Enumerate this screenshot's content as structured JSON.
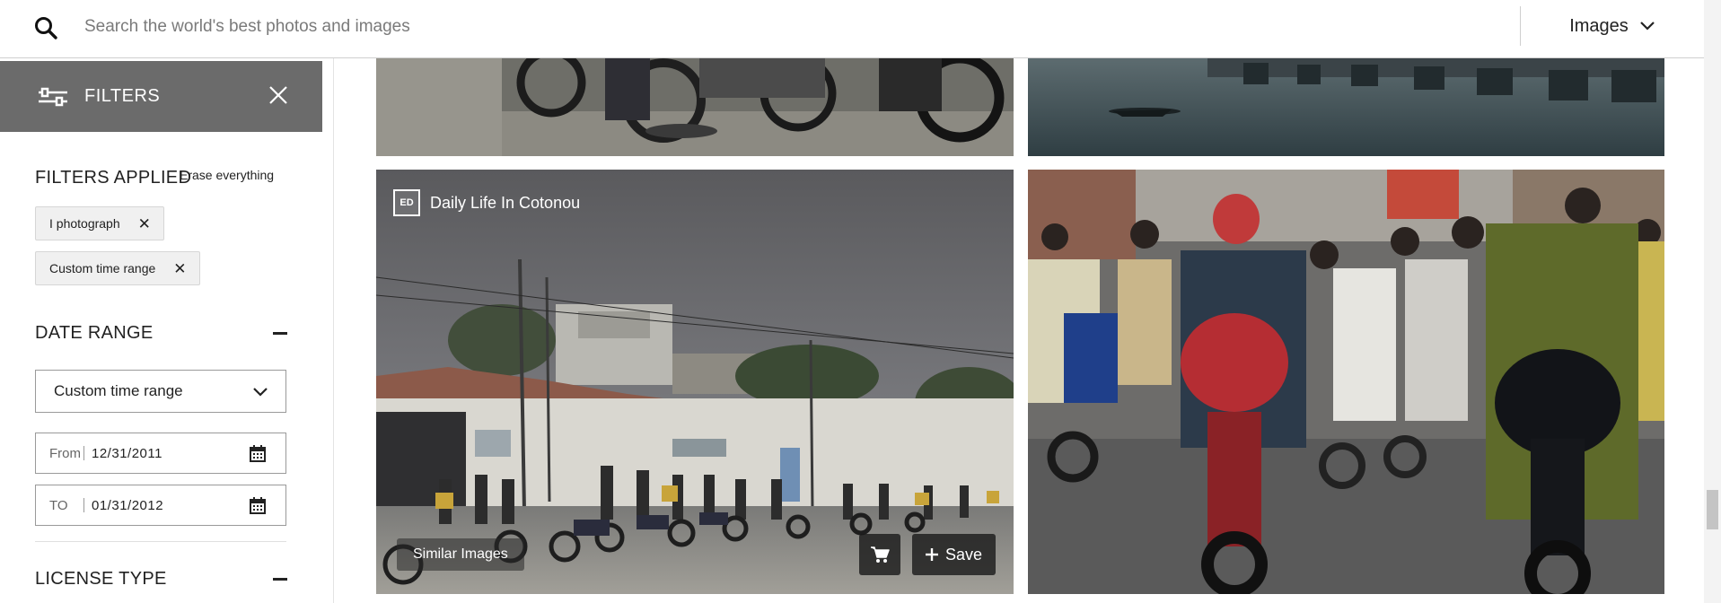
{
  "search": {
    "placeholder": "Search the world's best photos and images"
  },
  "type_selector": {
    "value": "Images"
  },
  "filters": {
    "title": "FILTERS",
    "applied_title": "FILTERS APPLIED",
    "erase_label": "Erase everything",
    "chips": [
      {
        "label": "I photograph"
      },
      {
        "label": "Custom time range"
      }
    ]
  },
  "date_range": {
    "title": "DATE RANGE",
    "selected_option": "Custom time range",
    "from_label": "From",
    "from_value": "12/31/2011",
    "to_label": "TO",
    "to_value": "01/31/2012"
  },
  "license_type": {
    "title": "LICENSE TYPE"
  },
  "images": {
    "featured": {
      "badge": "ED",
      "title": "Daily Life In Cotonou",
      "similar_label": "Similar Images",
      "save_label": "Save"
    }
  },
  "colors": {
    "filters_header_bg": "#6b6b6b",
    "chip_bg": "#f0f0f0",
    "text": "#222222"
  }
}
